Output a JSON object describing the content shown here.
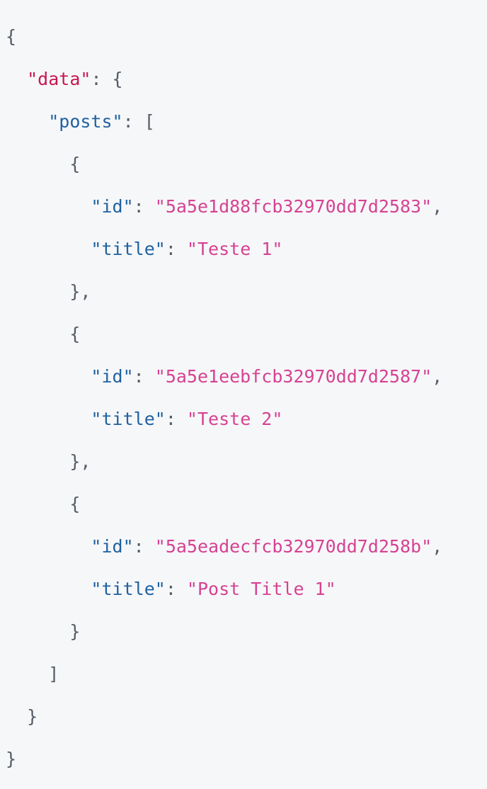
{
  "response": {
    "data_key": "data",
    "posts_key": "posts",
    "id_key": "id",
    "title_key": "title",
    "posts": [
      {
        "id": "5a5e1d88fcb32970dd7d2583",
        "title": "Teste 1"
      },
      {
        "id": "5a5e1eebfcb32970dd7d2587",
        "title": "Teste 2"
      },
      {
        "id": "5a5eadecfcb32970dd7d258b",
        "title": "Post Title 1"
      }
    ]
  },
  "colors": {
    "background": "#f6f7f9",
    "top_key": "#c8174f",
    "key": "#1f61a0",
    "string": "#d64292",
    "punctuation": "#555c66"
  }
}
